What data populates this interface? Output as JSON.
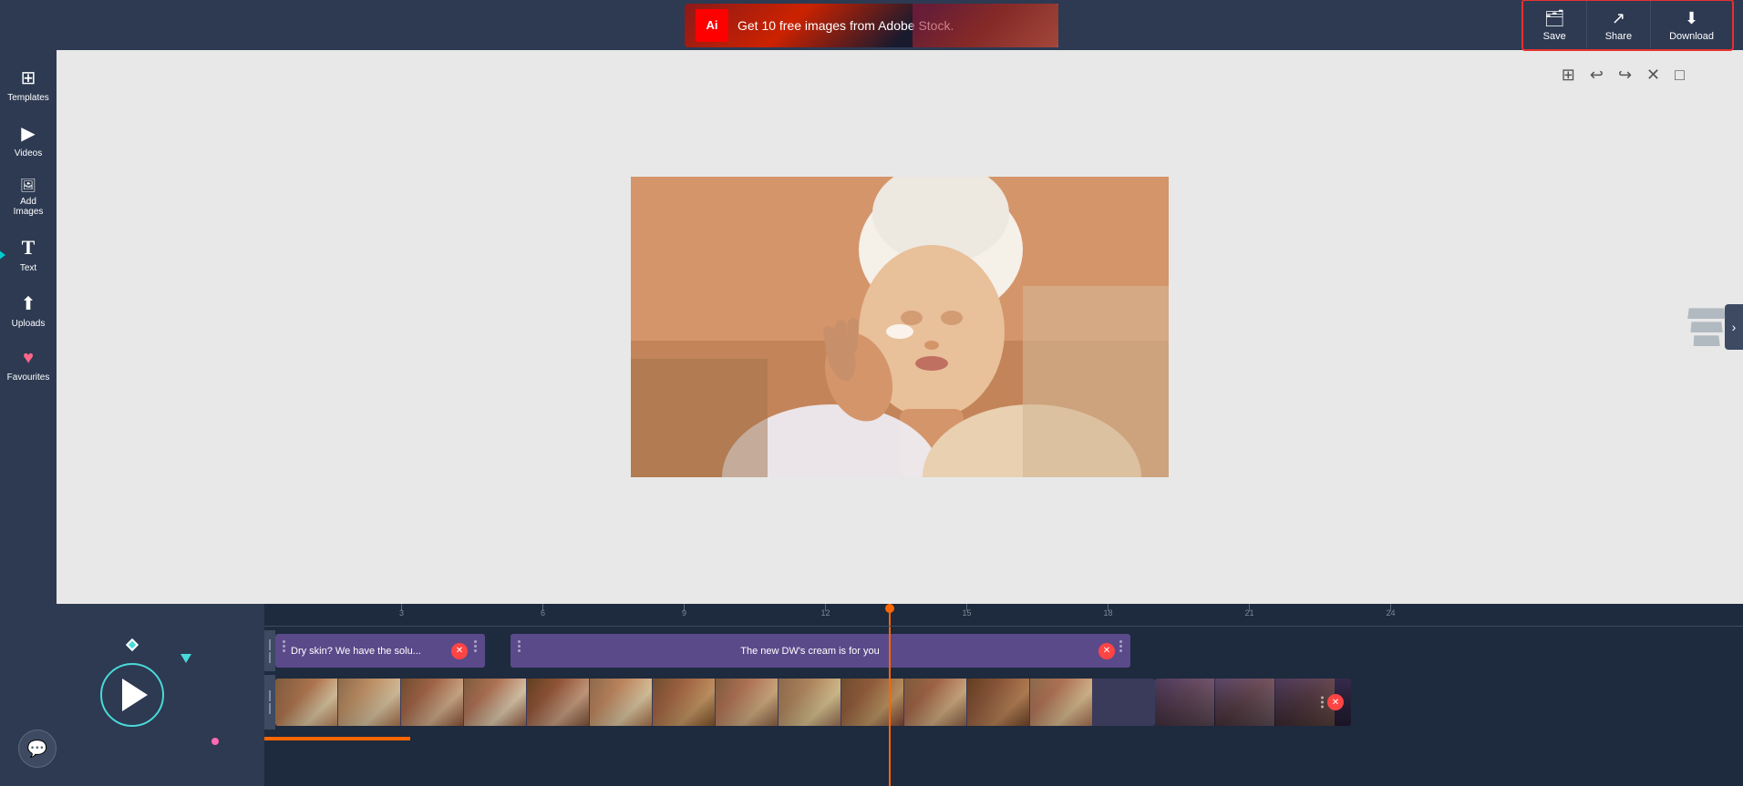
{
  "topbar": {
    "adobe_text": "Get 10 free images from Adobe Stock.",
    "adobe_logo": "Adobe",
    "save_label": "Save",
    "share_label": "Share",
    "download_label": "Download"
  },
  "sidebar": {
    "items": [
      {
        "label": "Templates",
        "icon": "⊞"
      },
      {
        "label": "Videos",
        "icon": "🎬"
      },
      {
        "label": "Add Images",
        "icon": "🖼"
      },
      {
        "label": "Text",
        "icon": "T"
      },
      {
        "label": "Uploads",
        "icon": "⬆"
      },
      {
        "label": "Favourites",
        "icon": "♥"
      }
    ]
  },
  "canvas": {
    "toolbar": {
      "grid_icon": "⊞",
      "undo_icon": "↩",
      "redo_icon": "↪",
      "close_icon": "✕",
      "expand_icon": "□"
    }
  },
  "timeline": {
    "ruler_marks": [
      "3",
      "6",
      "9",
      "12",
      "15",
      "18",
      "21",
      "24"
    ],
    "clips": {
      "text_clip1": "Dry skin? We have the solu...",
      "text_clip2": "The new DW's cream is for you"
    },
    "playhead_position": "685px"
  }
}
